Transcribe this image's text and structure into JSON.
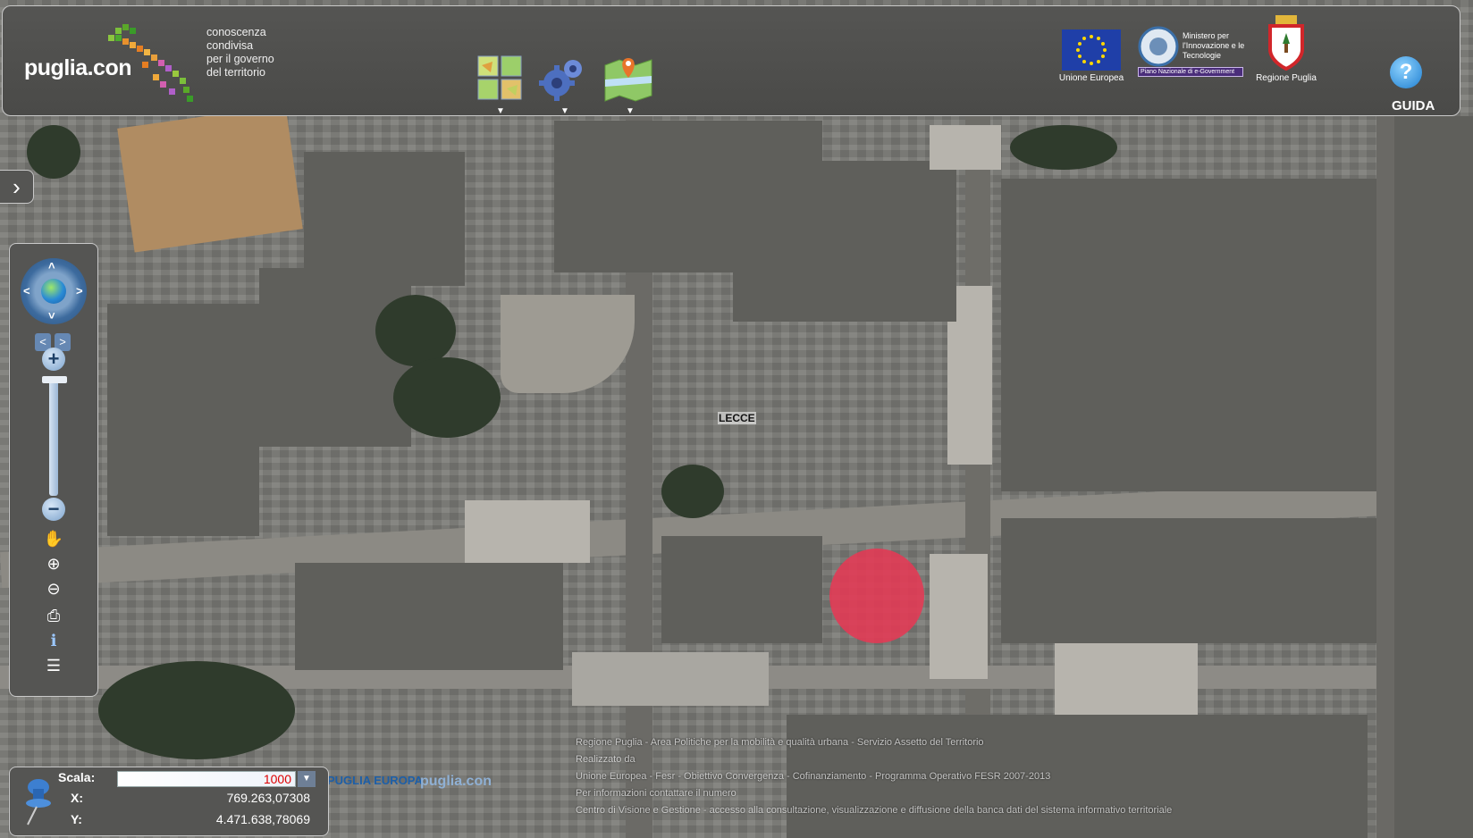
{
  "header": {
    "logo_text": "puglia.con",
    "tagline": [
      "conoscenza",
      "condivisa",
      "per il governo",
      "del territorio"
    ],
    "tools": [
      {
        "name": "layers",
        "icon": "layers-grid-icon"
      },
      {
        "name": "settings",
        "icon": "gears-icon"
      },
      {
        "name": "map",
        "icon": "map-pin-icon"
      }
    ],
    "tool_arrow": "▼",
    "partners": [
      {
        "label": "Unione Europea",
        "icon": "eu-flag-icon"
      },
      {
        "label": "Ministero per l'Innovazione e le Tecnologie",
        "icon": "ministry-seal-icon",
        "sub": "Piano Nazionale di e-Government"
      },
      {
        "label": "Regione Puglia",
        "icon": "regione-puglia-crest-icon"
      }
    ],
    "help_symbol": "?",
    "help_label": "GUIDA"
  },
  "side_tab": {
    "symbol": "›"
  },
  "nav": {
    "pan_arrows": {
      "up": "˄",
      "down": "˅",
      "left": "<",
      "right": ">"
    },
    "history": {
      "back": "<",
      "forward": ">"
    },
    "zoom_in": "+",
    "zoom_out": "−",
    "tools": [
      {
        "name": "pan-hand",
        "symbol": "✋"
      },
      {
        "name": "zoom-in-tool",
        "symbol": "⊕"
      },
      {
        "name": "zoom-out-tool",
        "symbol": "⊖"
      },
      {
        "name": "print",
        "symbol": "⎙"
      },
      {
        "name": "info",
        "symbol": "ℹ"
      },
      {
        "name": "legend",
        "symbol": "☰"
      }
    ]
  },
  "map": {
    "city_label": "LECCE"
  },
  "coords": {
    "scale_label": "Scala:",
    "scale_value": "1000",
    "x_label": "X:",
    "x_value": "769.263,07308",
    "y_label": "Y:",
    "y_value": "4.471.638,78069"
  },
  "footer": {
    "lines": [
      "Regione Puglia - Area Politiche per la mobilità e qualità urbana - Servizio Assetto del Territorio",
      "Realizzato da",
      "Unione Europea - Fesr - Obiettivo Convergenza - Cofinanziamento - Programma Operativo FESR 2007-2013",
      "Per informazioni contattare il numero",
      "Centro di Visione e Gestione - accesso alla consultazione, visualizzazione e diffusione della banca dati del sistema informativo territoriale"
    ],
    "logo1": "PUGLIA EUROPA",
    "logo2": "puglia.con"
  },
  "colors": {
    "panel": "#555553",
    "marker": "#e53954",
    "accent": "#2a8bd6"
  }
}
